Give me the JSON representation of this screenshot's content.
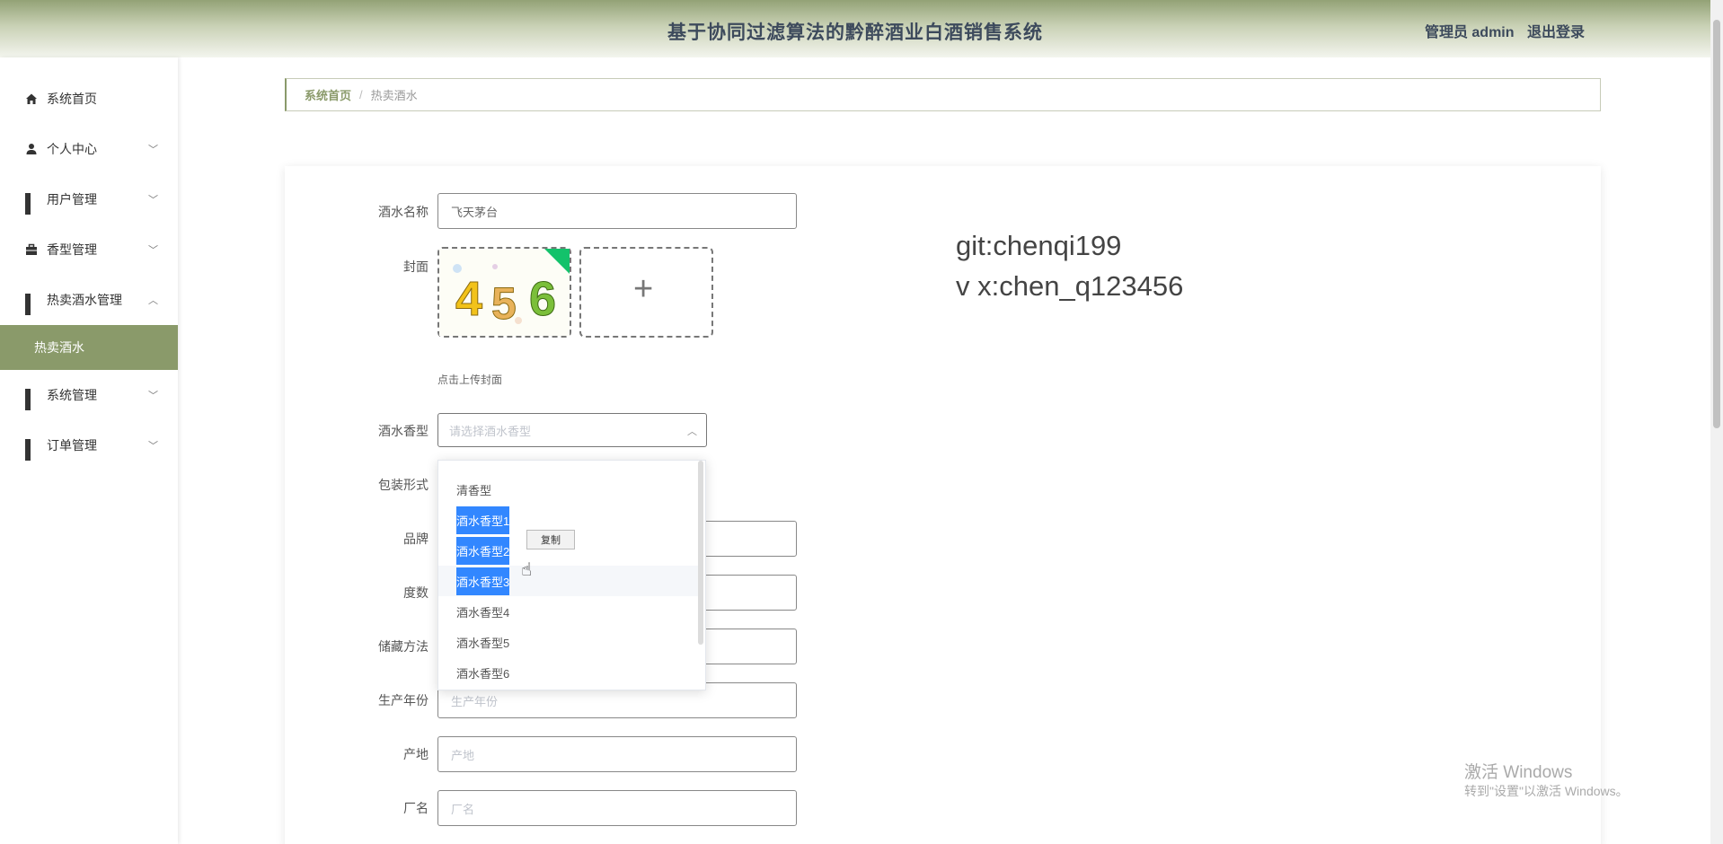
{
  "header": {
    "title": "基于协同过滤算法的黔醉酒业白酒销售系统",
    "user": "管理员 admin",
    "logout": "退出登录"
  },
  "sidebar": {
    "items": [
      {
        "label": "系统首页",
        "icon": "home-icon"
      },
      {
        "label": "个人中心",
        "icon": "user-icon"
      },
      {
        "label": "用户管理",
        "icon": "grid-icon"
      },
      {
        "label": "香型管理",
        "icon": "briefcase-icon"
      },
      {
        "label": "热卖酒水管理",
        "icon": "grid-icon"
      },
      {
        "label": "热卖酒水",
        "icon": ""
      },
      {
        "label": "系统管理",
        "icon": "grid-icon"
      },
      {
        "label": "订单管理",
        "icon": "grid-icon"
      }
    ]
  },
  "breadcrumb": {
    "home": "系统首页",
    "current": "热卖酒水"
  },
  "form": {
    "name_label": "酒水名称",
    "name_value": "飞天茅台",
    "cover_label": "封面",
    "cover_hint": "点击上传封面",
    "aroma_label": "酒水香型",
    "aroma_placeholder": "请选择酒水香型",
    "package_label": "包装形式",
    "brand_label": "品牌",
    "degree_label": "度数",
    "storage_label": "储藏方法",
    "year_label": "生产年份",
    "year_placeholder": "生产年份",
    "origin_label": "产地",
    "origin_placeholder": "产地",
    "factory_label": "厂名",
    "factory_placeholder": "厂名"
  },
  "dropdown": {
    "options": [
      "清香型",
      "酒水香型1",
      "酒水香型2",
      "酒水香型3",
      "酒水香型4",
      "酒水香型5",
      "酒水香型6"
    ],
    "copy_label": "复制"
  },
  "watermark": {
    "line1": "git:chenqi199",
    "line2": "v x:chen_q123456"
  },
  "activation": {
    "line1": "激活 Windows",
    "line2": "转到\"设置\"以激活 Windows。"
  },
  "cover_image": {
    "digits": [
      "4",
      "5",
      "6"
    ]
  },
  "colors": {
    "accent": "#8a9a6a",
    "selection": "#3287ff"
  }
}
